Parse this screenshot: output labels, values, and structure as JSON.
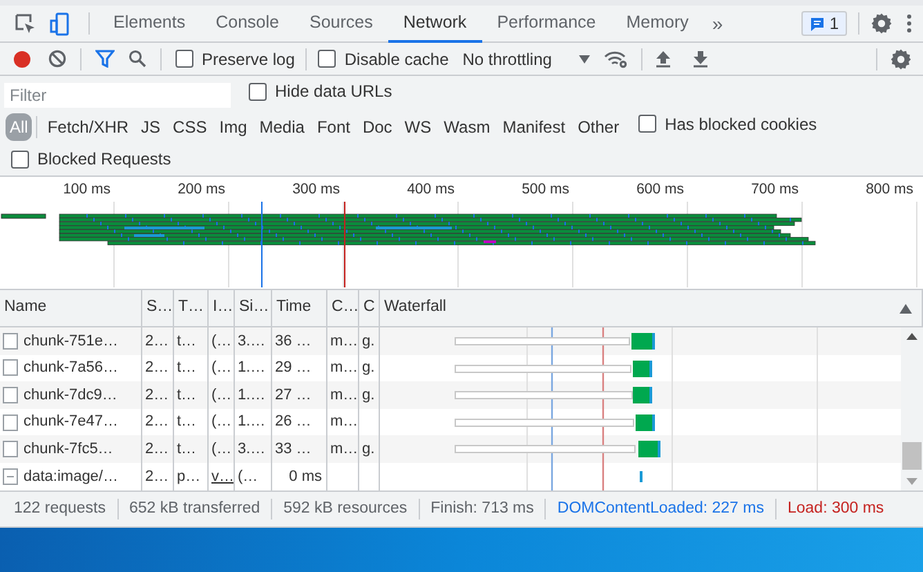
{
  "tabs": [
    {
      "label": "Elements",
      "selected": false
    },
    {
      "label": "Console",
      "selected": false
    },
    {
      "label": "Sources",
      "selected": false
    },
    {
      "label": "Network",
      "selected": true
    },
    {
      "label": "Performance",
      "selected": false
    },
    {
      "label": "Memory",
      "selected": false
    }
  ],
  "more_tabs": "»",
  "issues_badge": "1",
  "toolbar": {
    "recording": true,
    "preserve_log": {
      "label": "Preserve log",
      "checked": false
    },
    "disable_cache": {
      "label": "Disable cache",
      "checked": false
    },
    "throttling": "No throttling"
  },
  "filter": {
    "placeholder": "Filter",
    "hide_data_urls": {
      "label": "Hide data URLs",
      "checked": false
    }
  },
  "type_filters": [
    {
      "label": "All",
      "selected": true
    },
    {
      "label": "Fetch/XHR",
      "selected": false
    },
    {
      "label": "JS",
      "selected": false
    },
    {
      "label": "CSS",
      "selected": false
    },
    {
      "label": "Img",
      "selected": false
    },
    {
      "label": "Media",
      "selected": false
    },
    {
      "label": "Font",
      "selected": false
    },
    {
      "label": "Doc",
      "selected": false
    },
    {
      "label": "WS",
      "selected": false
    },
    {
      "label": "Wasm",
      "selected": false
    },
    {
      "label": "Manifest",
      "selected": false
    },
    {
      "label": "Other",
      "selected": false
    }
  ],
  "has_blocked_cookies": {
    "label": "Has blocked cookies",
    "checked": false
  },
  "blocked_requests": {
    "label": "Blocked Requests",
    "checked": false
  },
  "overview": {
    "ticks": [
      "100 ms",
      "200 ms",
      "300 ms",
      "400 ms",
      "500 ms",
      "600 ms",
      "700 ms",
      "800 ms"
    ]
  },
  "table": {
    "columns": [
      "Name",
      "S…",
      "T…",
      "I…",
      "Si…",
      "Time",
      "C…",
      "C",
      "Waterfall"
    ],
    "rows": [
      {
        "kind": "script",
        "cells": [
          "chunk-751e…",
          "2…",
          "t…",
          "(…",
          "3.…",
          "36 …",
          "m…",
          "g."
        ]
      },
      {
        "kind": "script",
        "cells": [
          "chunk-7a56…",
          "2…",
          "t…",
          "(…",
          "1.…",
          "29 …",
          "m…",
          "g."
        ]
      },
      {
        "kind": "script",
        "cells": [
          "chunk-7dc9…",
          "2…",
          "t…",
          "(…",
          "1.…",
          "27 …",
          "m…",
          "g."
        ]
      },
      {
        "kind": "script",
        "cells": [
          "chunk-7e47…",
          "2…",
          "t…",
          "(…",
          "1.…",
          "26 …",
          "m…"
        ]
      },
      {
        "kind": "script",
        "cells": [
          "chunk-7fc5…",
          "2…",
          "t…",
          "(…",
          "3.…",
          "33 …",
          "m…",
          "g."
        ]
      },
      {
        "kind": "data",
        "cells": [
          "data:image/…",
          "2…",
          "p…",
          "v…",
          "(…",
          "0 ms"
        ]
      }
    ]
  },
  "status_bar": [
    {
      "text": "122 requests",
      "kind": "plain"
    },
    {
      "text": "652 kB transferred",
      "kind": "plain"
    },
    {
      "text": "592 kB resources",
      "kind": "plain"
    },
    {
      "text": "Finish: 713 ms",
      "kind": "plain"
    },
    {
      "text": "DOMContentLoaded: 227 ms",
      "kind": "dom"
    },
    {
      "text": "Load: 300 ms",
      "kind": "load"
    }
  ]
}
